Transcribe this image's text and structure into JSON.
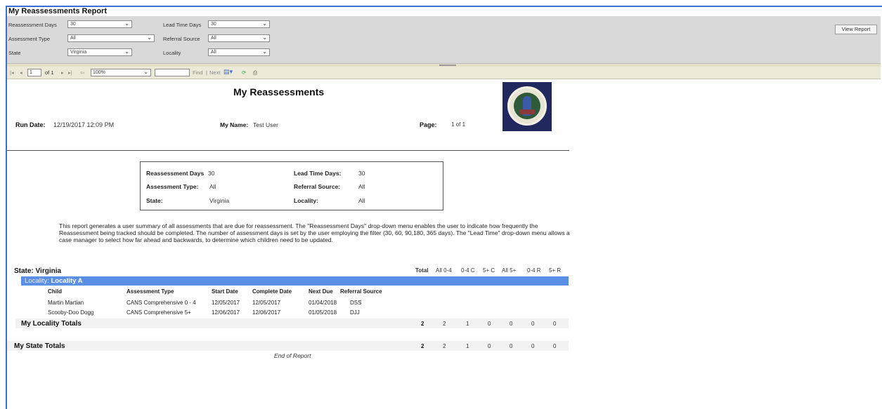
{
  "window": {
    "title": "My Reassessments Report"
  },
  "params": {
    "reassessment_days": {
      "label": "Reassessment Days",
      "value": "30"
    },
    "lead_time_days": {
      "label": "Lead Time Days",
      "value": "30"
    },
    "assessment_type": {
      "label": "Assessment Type",
      "value": "All"
    },
    "referral_source": {
      "label": "Referral Source",
      "value": "All"
    },
    "state": {
      "label": "State",
      "value": "Virginia"
    },
    "locality": {
      "label": "Locality",
      "value": "All"
    },
    "view_report_label": "View Report"
  },
  "toolbar": {
    "page_value": "1",
    "page_of": "of 1",
    "zoom": "100%",
    "find_label": "Find",
    "next_label": "Next",
    "separator": "|"
  },
  "report": {
    "title": "My Reassessments",
    "run_date_label": "Run Date:",
    "run_date_value": "12/19/2017 12:09 PM",
    "my_name_label": "My Name:",
    "my_name_value": "Test User",
    "page_label": "Page:",
    "page_value": "1 of 1",
    "param_box": {
      "reassessment_days_label": "Reassessment Days",
      "reassessment_days_value": "30",
      "lead_time_label": "Lead Time Days:",
      "lead_time_value": "30",
      "assessment_type_label": "Assessment Type:",
      "assessment_type_value": "All",
      "referral_source_label": "Referral Source:",
      "referral_source_value": "All",
      "state_label": "State:",
      "state_value": "Virginia",
      "locality_label": "Locality:",
      "locality_value": "All"
    },
    "description": "This report generates a user summary of all assessments that are due for reassessment. The \"Reassessment Days\" drop-down menu enables the user to indicate how frequently the Reassessment being tracked should be completed.  The number of assessment days is set by the user employing the filter (30, 60, 90,180, 365 days).  The \"Lead Time\" drop-down menu allows a case manager to select how far ahead and backwards, to determine which children need to be updated.",
    "state_row": "State:  Virginia",
    "summary_headers": [
      "Total",
      "All 0-4",
      "0-4 C",
      "5+ C",
      "All 5+",
      "0-4 R",
      "5+ R"
    ],
    "locality_prefix": "Locality:",
    "locality_name": "Locality A",
    "columns": [
      "Child",
      "Assessment Type",
      "Start Date",
      "Complete Date",
      "Next Due",
      "Referral Source"
    ],
    "rows": [
      [
        "Martin Martian",
        "CANS Comprehensive 0 - 4",
        "12/05/2017",
        "12/05/2017",
        "01/04/2018",
        "DSS"
      ],
      [
        "Scooby-Doo Dogg",
        "CANS Comprehensive 5+",
        "12/06/2017",
        "12/06/2017",
        "01/05/2018",
        "DJJ"
      ]
    ],
    "locality_totals": {
      "label": "My Locality Totals",
      "values": [
        "2",
        "2",
        "1",
        "0",
        "0",
        "0",
        "0"
      ]
    },
    "state_totals": {
      "label": "My State Totals",
      "values": [
        "2",
        "2",
        "1",
        "0",
        "0",
        "0",
        "0"
      ]
    },
    "end": "End of Report"
  }
}
